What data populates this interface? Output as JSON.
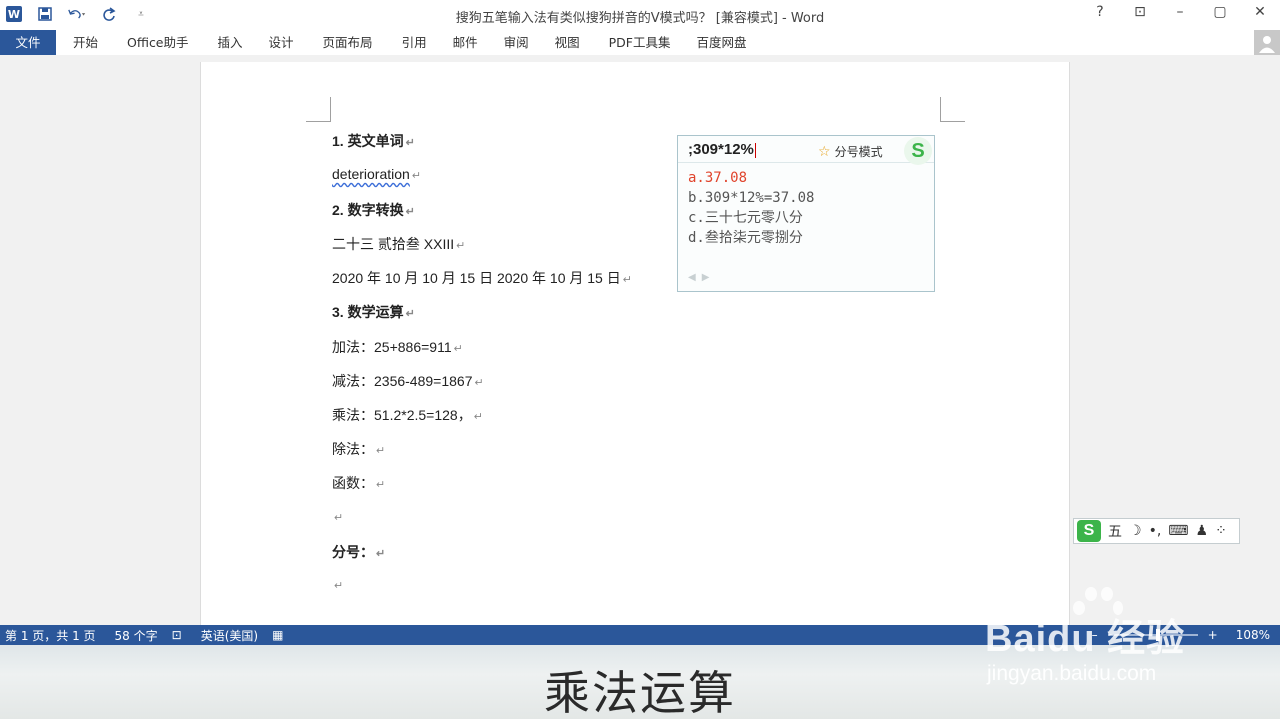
{
  "window": {
    "title": "搜狗五笔输入法有类似搜狗拼音的V模式吗？ [兼容模式] - Word",
    "controls": [
      "?",
      "⊡",
      "–",
      "▢",
      "✕"
    ]
  },
  "qat": {
    "app_icon": "W",
    "save": "save-icon",
    "undo": "undo-icon",
    "redo": "redo-icon",
    "more": "customize-icon"
  },
  "tabs": [
    "文件",
    "开始",
    "Office助手",
    "插入",
    "设计",
    "页面布局",
    "引用",
    "邮件",
    "审阅",
    "视图",
    "PDF工具集",
    "百度网盘"
  ],
  "document": {
    "lines": [
      {
        "text": "1.   英文单词",
        "bold": true
      },
      {
        "text": "deterioration",
        "squiggle": true
      },
      {
        "text": "2.   数字转换",
        "bold": true
      },
      {
        "text": "二十三  贰拾叁  XXIII"
      },
      {
        "text": "2020 年 10 月  10 月 15 日  2020 年 10 月 15 日"
      },
      {
        "text": "3.   数学运算",
        "bold": true
      },
      {
        "text": "加法：25+886=911"
      },
      {
        "text": "减法：2356-489=1867"
      },
      {
        "text": "乘法：51.2*2.5=128，"
      },
      {
        "text": "除法："
      },
      {
        "text": "函数："
      },
      {
        "text": ""
      },
      {
        "text": "分号：",
        "bold": true
      },
      {
        "text": ""
      }
    ],
    "paragraph_mark": "↵"
  },
  "ime": {
    "input": ";309*12%",
    "mode_label": "分号模式",
    "logo": "S",
    "candidates": [
      {
        "key": "a.",
        "text": "37.08"
      },
      {
        "key": "b.",
        "text": "309*12%=37.08"
      },
      {
        "key": "c.",
        "text": "三十七元零八分"
      },
      {
        "key": "d.",
        "text": "叁拾柒元零捌分"
      }
    ],
    "nav": [
      "◀",
      "▶"
    ]
  },
  "ime_toolbar": {
    "logo": "S",
    "mode": "五",
    "items": [
      "☽",
      "•,",
      "⌨",
      "♟",
      "⁘"
    ]
  },
  "statusbar": {
    "page": "第 1 页，共 1 页",
    "words": "58 个字",
    "language": "英语(美国)",
    "zoom": "108%",
    "zoom_minus": "–",
    "zoom_plus": "+"
  },
  "caption": "乘法运算",
  "watermark": {
    "logo": "Baidu 经验",
    "url": "jingyan.baidu.com"
  },
  "colors": {
    "word_blue": "#2b579a",
    "candidate_red": "#e0442c",
    "sogou_green": "#3cb44a"
  }
}
